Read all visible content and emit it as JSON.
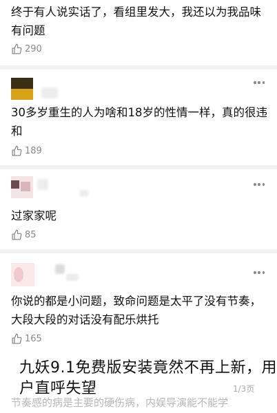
{
  "comments": [
    {
      "text": "终于有人说实话了，看组里发大，我还以为我品味有问题",
      "likes": "290"
    },
    {
      "text": "30多岁重生的人为啥和18岁的性情一样，真的很违和",
      "likes": "189"
    },
    {
      "text": "过家家呢",
      "likes": "85"
    },
    {
      "text": "你说的都是小问题，致命问题是太平了没有节奏，大段大段的对话没有配乐烘托",
      "likes": "165"
    }
  ],
  "overlay_title": "九妖9.1免费版安装竟然不再上新，用户直呼失望",
  "bottom_faded_text": "节奏感的病是主要的硬伤病，内娱导演能不能学",
  "page_indicator": "1/3页",
  "colors": {
    "divider": "#f2f2f2",
    "meta": "#8a8a8a"
  }
}
